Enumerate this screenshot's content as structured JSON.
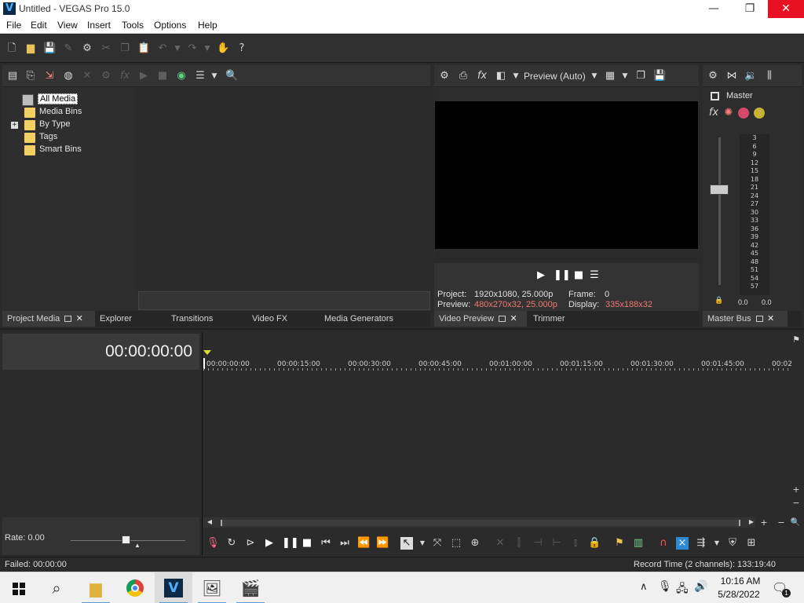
{
  "window": {
    "title": "Untitled - VEGAS Pro 15.0",
    "app_icon_letter": "V",
    "minimize_glyph": "—",
    "maximize_glyph": "❐",
    "close_glyph": "✕"
  },
  "menu": [
    "File",
    "Edit",
    "View",
    "Insert",
    "Tools",
    "Options",
    "Help"
  ],
  "project_media": {
    "tree": [
      {
        "label": "All Media",
        "selected": true
      },
      {
        "label": "Media Bins"
      },
      {
        "label": "By Type",
        "expander": "+"
      },
      {
        "label": "Tags"
      },
      {
        "label": "Smart Bins"
      }
    ]
  },
  "left_tabs": [
    {
      "label": "Project Media",
      "active": true
    },
    {
      "label": "Explorer"
    },
    {
      "label": "Transitions"
    },
    {
      "label": "Video FX"
    },
    {
      "label": "Media Generators"
    }
  ],
  "preview": {
    "mode_label": "Preview (Auto)",
    "project_label": "Project:",
    "project_value": "1920x1080, 25.000p",
    "preview_label": "Preview:",
    "preview_value": "480x270x32, 25.000p",
    "frame_label": "Frame:",
    "frame_value": "0",
    "display_label": "Display:",
    "display_value": "335x188x32"
  },
  "preview_tabs": [
    {
      "label": "Video Preview",
      "active": true
    },
    {
      "label": "Trimmer"
    }
  ],
  "master": {
    "label": "Master",
    "scale": [
      "3",
      "6",
      "9",
      "12",
      "15",
      "18",
      "21",
      "24",
      "27",
      "30",
      "33",
      "36",
      "39",
      "42",
      "45",
      "48",
      "51",
      "54",
      "57"
    ],
    "level_left": "0.0",
    "level_right": "0.0",
    "tab_label": "Master Bus"
  },
  "timeline": {
    "timecode": "00:00:00:00",
    "ruler": [
      "00:00:00:00",
      "00:00:15:00",
      "00:00:30:00",
      "00:00:45:00",
      "00:01:00:00",
      "00:01:15:00",
      "00:01:30:00",
      "00:01:45:00",
      "00:02"
    ],
    "rate_label": "Rate: 0.00"
  },
  "status": {
    "left": "Failed: 00:00:00",
    "right": "Record Time (2 channels): 133:19:40"
  },
  "taskbar": {
    "time": "10:16 AM",
    "date": "5/28/2022",
    "notification_count": "1"
  }
}
